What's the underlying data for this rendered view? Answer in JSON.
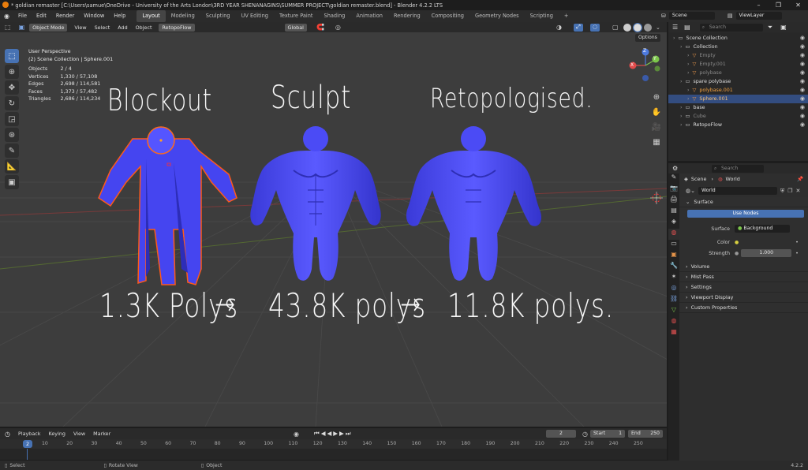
{
  "window": {
    "title": "* goldian remaster [C:\\Users\\samue\\OneDrive - University of the Arts London\\3RD YEAR SHENANAGINS\\SUMMER PROJECT\\goldian remaster.blend] - Blender 4.2.2 LTS"
  },
  "menu": [
    "File",
    "Edit",
    "Render",
    "Window",
    "Help"
  ],
  "workspaces": [
    "Layout",
    "Modeling",
    "Sculpting",
    "UV Editing",
    "Texture Paint",
    "Shading",
    "Animation",
    "Rendering",
    "Compositing",
    "Geometry Nodes",
    "Scripting"
  ],
  "workspace_add": "+",
  "scene": {
    "label": "Scene",
    "view_layer": "ViewLayer"
  },
  "header3d": {
    "mode": "Object Mode",
    "menus": [
      "View",
      "Select",
      "Add",
      "Object"
    ],
    "addon": "RetopoFlow",
    "orientation": "Global",
    "options": "Options"
  },
  "overlay": {
    "view": "User Perspective",
    "collection": "(2) Scene Collection | Sphere.001",
    "stats": [
      {
        "label": "Objects",
        "value": "2 / 4"
      },
      {
        "label": "Vertices",
        "value": "1,330 / 57,108"
      },
      {
        "label": "Edges",
        "value": "2,698 / 114,581"
      },
      {
        "label": "Faces",
        "value": "1,373 / 57,482"
      },
      {
        "label": "Triangles",
        "value": "2,686 / 114,234"
      }
    ]
  },
  "annotations": {
    "blockout": "Blockout",
    "sculpt": "Sculpt",
    "retopo": "Retopologised.",
    "polys1": "1.3K Polys",
    "arrow": "→",
    "polys2": "43.8K polys",
    "polys3": "11.8K polys."
  },
  "gizmo": {
    "x": "X",
    "y": "Y",
    "z": "Z"
  },
  "timeline": {
    "menus": [
      "Playback",
      "Keying",
      "View",
      "Marker"
    ],
    "current": "2",
    "start_label": "Start",
    "start": "1",
    "end_label": "End",
    "end": "250",
    "ticks": [
      "2",
      "10",
      "20",
      "30",
      "40",
      "50",
      "60",
      "70",
      "80",
      "90",
      "100",
      "110",
      "120",
      "130",
      "140",
      "150",
      "160",
      "170",
      "180",
      "190",
      "200",
      "210",
      "220",
      "230",
      "240",
      "250"
    ]
  },
  "status": {
    "select": "Select",
    "rotate": "Rotate View",
    "object": "Object",
    "version": "4.2.2"
  },
  "outliner": {
    "search_placeholder": "Search",
    "rows": [
      {
        "label": "Scene Collection",
        "indent": 0,
        "color": "#dddddd",
        "selected": false
      },
      {
        "label": "Collection",
        "indent": 1,
        "color": "#dddddd",
        "selected": false
      },
      {
        "label": "Empty",
        "indent": 2,
        "color": "#8a8a8a",
        "selected": false
      },
      {
        "label": "Empty.001",
        "indent": 2,
        "color": "#8a8a8a",
        "selected": false
      },
      {
        "label": "polybase",
        "indent": 2,
        "color": "#8a8a8a",
        "selected": false
      },
      {
        "label": "spare polybase",
        "indent": 1,
        "color": "#dddddd",
        "selected": false
      },
      {
        "label": "polybase.001",
        "indent": 2,
        "color": "#f0a040",
        "selected": false
      },
      {
        "label": "Sphere.001",
        "indent": 2,
        "color": "#f5c27a",
        "selected": true
      },
      {
        "label": "base",
        "indent": 1,
        "color": "#dddddd",
        "selected": false
      },
      {
        "label": "Cube",
        "indent": 1,
        "color": "#8a8a8a",
        "selected": false
      },
      {
        "label": "RetopoFlow",
        "indent": 1,
        "color": "#dddddd",
        "selected": false
      }
    ]
  },
  "properties": {
    "search_placeholder": "Search",
    "breadcrumb_scene": "Scene",
    "breadcrumb_world": "World",
    "world_name": "World",
    "surface_panel": "Surface",
    "use_nodes": "Use Nodes",
    "surface_label": "Surface",
    "surface_value": "Background",
    "color_label": "Color",
    "strength_label": "Strength",
    "strength_value": "1.000",
    "panels": [
      "Volume",
      "Mist Pass",
      "Settings",
      "Viewport Display",
      "Custom Properties"
    ]
  }
}
